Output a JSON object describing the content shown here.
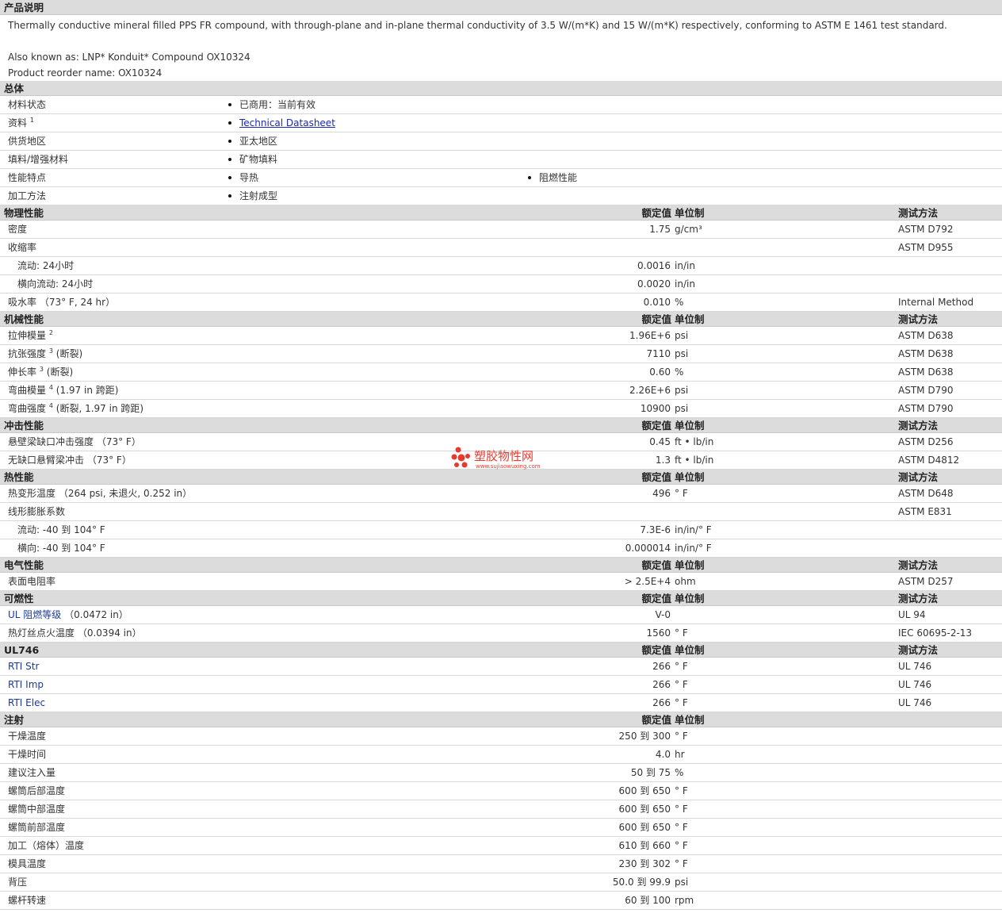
{
  "description": {
    "title": "产品说明",
    "text": "Thermally conductive mineral filled PPS FR compound, with through-plane and in-plane thermal conductivity of 3.5 W/(m*K) and 15 W/(m*K) respectively, conforming to ASTM E 1461 test standard.",
    "aka": "Also known as: LNP* Konduit* Compound OX10324",
    "reorder": "Product reorder name: OX10324"
  },
  "general": {
    "title": "总体",
    "rows": [
      {
        "label": "材料状态",
        "b1": "已商用：当前有效",
        "b2": ""
      },
      {
        "label": "资料",
        "sup": "1",
        "b1": "Technical Datasheet",
        "b2": "",
        "link": true
      },
      {
        "label": "供货地区",
        "b1": "亚太地区",
        "b2": ""
      },
      {
        "label": "填料/增强材料",
        "b1": "矿物填料",
        "b2": ""
      },
      {
        "label": "性能特点",
        "b1": "导热",
        "b2": "阻燃性能"
      },
      {
        "label": "加工方法",
        "b1": "注射成型",
        "b2": ""
      }
    ]
  },
  "col_headers": {
    "value": "额定值",
    "unit": "单位制",
    "test": "测试方法"
  },
  "sections": [
    {
      "title": "物理性能",
      "rows": [
        {
          "label": "密度",
          "value": "1.75",
          "unit": "g/cm³",
          "test": "ASTM D792"
        },
        {
          "label": "收缩率",
          "value": "",
          "unit": "",
          "test": "ASTM D955"
        },
        {
          "label": "流动: 24小时",
          "value": "0.0016",
          "unit": "in/in",
          "test": "",
          "indent": true
        },
        {
          "label": "横向流动: 24小时",
          "value": "0.0020",
          "unit": "in/in",
          "test": "",
          "indent": true
        },
        {
          "label": "吸水率",
          "cond": "（73°  F, 24 hr）",
          "value": "0.010",
          "unit": "%",
          "test": "Internal Method"
        }
      ]
    },
    {
      "title": "机械性能",
      "rows": [
        {
          "label": "拉伸模量",
          "sup": "2",
          "value": "1.96E+6",
          "unit": "psi",
          "test": "ASTM D638"
        },
        {
          "label": "抗张强度",
          "sup": "3",
          "cond": "(断裂)",
          "value": "7110",
          "unit": "psi",
          "test": "ASTM D638"
        },
        {
          "label": "伸长率",
          "sup": "3",
          "cond": "(断裂)",
          "value": "0.60",
          "unit": "%",
          "test": "ASTM D638"
        },
        {
          "label": "弯曲模量",
          "sup": "4",
          "cond": "(1.97 in 跨距)",
          "value": "2.26E+6",
          "unit": "psi",
          "test": "ASTM D790"
        },
        {
          "label": "弯曲强度",
          "sup": "4",
          "cond": "(断裂, 1.97 in 跨距)",
          "value": "10900",
          "unit": "psi",
          "test": "ASTM D790"
        }
      ]
    },
    {
      "title": "冲击性能",
      "rows": [
        {
          "label": "悬壁梁缺口冲击强度",
          "cond": "（73°  F）",
          "value": "0.45",
          "unit": "ft • lb/in",
          "test": "ASTM D256"
        },
        {
          "label": "无缺口悬臂梁冲击",
          "cond": "（73°  F）",
          "value": "1.3",
          "unit": "ft • lb/in",
          "test": "ASTM D4812"
        }
      ]
    },
    {
      "title": "热性能",
      "rows": [
        {
          "label": "热变形温度",
          "cond": "（264 psi, 未退火, 0.252 in）",
          "value": "496",
          "unit": "°  F",
          "test": "ASTM D648"
        },
        {
          "label": "线形膨胀系数",
          "value": "",
          "unit": "",
          "test": "ASTM E831"
        },
        {
          "label": "流动: -40 到  104°  F",
          "value": "7.3E-6",
          "unit": "in/in/°  F",
          "test": "",
          "indent": true
        },
        {
          "label": "横向: -40 到  104°  F",
          "value": "0.000014",
          "unit": "in/in/°  F",
          "test": "",
          "indent": true
        }
      ]
    },
    {
      "title": "电气性能",
      "rows": [
        {
          "label": "表面电阻率",
          "value": "> 2.5E+4",
          "unit": "ohm",
          "test": "ASTM D257"
        }
      ]
    },
    {
      "title": "可燃性",
      "rows": [
        {
          "label": "UL 阻燃等级",
          "cond": "（0.0472 in）",
          "value": "V-0",
          "unit": "",
          "test": "UL 94",
          "blue": true
        },
        {
          "label": "热灯丝点火温度",
          "cond": "（0.0394 in）",
          "value": "1560",
          "unit": "°  F",
          "test": "IEC 60695-2-13"
        }
      ]
    },
    {
      "title": "UL746",
      "rows": [
        {
          "label": "RTI Str",
          "value": "266",
          "unit": "°  F",
          "test": "UL 746",
          "blue": true
        },
        {
          "label": "RTI Imp",
          "value": "266",
          "unit": "°  F",
          "test": "UL 746",
          "blue": true
        },
        {
          "label": "RTI Elec",
          "value": "266",
          "unit": "°  F",
          "test": "UL 746",
          "blue": true
        }
      ]
    },
    {
      "title": "注射",
      "notest": true,
      "rows": [
        {
          "label": "干燥温度",
          "value": "250 到  300",
          "unit": "°  F",
          "test": ""
        },
        {
          "label": "干燥时间",
          "value": "4.0",
          "unit": "hr",
          "test": ""
        },
        {
          "label": "建议注入量",
          "value": "50 到  75",
          "unit": "%",
          "test": ""
        },
        {
          "label": "螺筒后部温度",
          "value": "600 到  650",
          "unit": "°  F",
          "test": ""
        },
        {
          "label": "螺筒中部温度",
          "value": "600 到  650",
          "unit": "°  F",
          "test": ""
        },
        {
          "label": "螺筒前部温度",
          "value": "600 到  650",
          "unit": "°  F",
          "test": ""
        },
        {
          "label": "加工（熔体）温度",
          "value": "610 到  660",
          "unit": "°  F",
          "test": ""
        },
        {
          "label": "模具温度",
          "value": "230 到  302",
          "unit": "°  F",
          "test": ""
        },
        {
          "label": "背压",
          "value": "50.0 到  99.9",
          "unit": "psi",
          "test": ""
        },
        {
          "label": "螺杆转速",
          "value": "60 到  100",
          "unit": "rpm",
          "test": ""
        }
      ]
    }
  ],
  "watermark": {
    "title": "塑胶物性网",
    "url": "www.sujiaowuxing.com",
    "color": "#e8392e"
  }
}
